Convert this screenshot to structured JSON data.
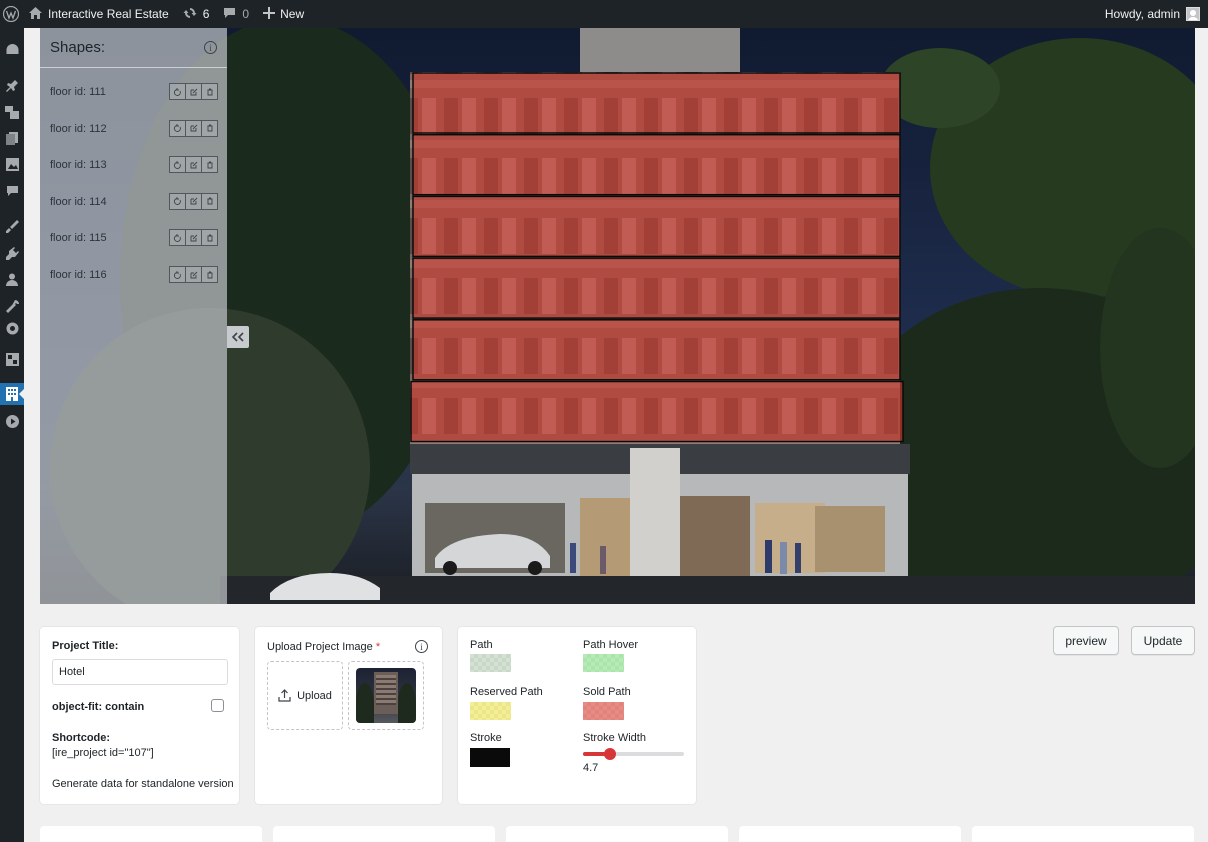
{
  "adminbar": {
    "site_name": "Interactive Real Estate",
    "updates_count": "6",
    "comments_count": "0",
    "new_label": "New",
    "howdy": "Howdy, admin",
    "icons": [
      "wordpress-logo-icon",
      "home-icon",
      "updates-icon",
      "comment-icon",
      "plus-icon",
      "avatar"
    ]
  },
  "adminmenu": {
    "items": [
      "dashboard-icon",
      "posts-icon",
      "media-icon",
      "pages-icon",
      "gallery-icon",
      "comments-icon",
      "appearance-icon",
      "plugins-icon",
      "users-icon",
      "tools-icon",
      "settings-icon",
      "blocks-icon",
      "interactive-real-estate-icon",
      "play-icon"
    ],
    "active": "interactive-real-estate-icon"
  },
  "shapes_panel": {
    "title": "Shapes:",
    "items": [
      {
        "label": "floor id: 111"
      },
      {
        "label": "floor id: 112"
      },
      {
        "label": "floor id: 113"
      },
      {
        "label": "floor id: 114"
      },
      {
        "label": "floor id: 115"
      },
      {
        "label": "floor id: 116"
      }
    ],
    "item_actions": [
      "refresh-icon",
      "edit-icon",
      "delete-icon"
    ],
    "highlight_color": "#c8322a",
    "overlay_color": "rgba(215,55,45,0.58)"
  },
  "project": {
    "title_label": "Project Title:",
    "title_value": "Hotel",
    "object_fit_label": "object-fit: contain",
    "object_fit_checked": false,
    "shortcode_label": "Shortcode:",
    "shortcode_value": "[ire_project id=\"107\"]",
    "generate_label": "Generate data for standalone version"
  },
  "upload": {
    "label": "Upload Project Image",
    "required_mark": "*",
    "button_label": "Upload"
  },
  "colors": {
    "path_label": "Path",
    "path_color": "rgba(160,190,160,0.45)",
    "path_hover_label": "Path Hover",
    "path_hover_color": "rgba(120,220,120,0.55)",
    "reserved_label": "Reserved Path",
    "reserved_color": "rgba(235,225,60,0.55)",
    "sold_label": "Sold Path",
    "sold_color": "rgba(215,55,45,0.58)",
    "stroke_label": "Stroke",
    "stroke_color": "#0a0a0a",
    "stroke_width_label": "Stroke Width",
    "stroke_width_value": "4.7",
    "stroke_width_fraction": 0.27,
    "slider_color": "#d63638"
  },
  "actions": {
    "preview_label": "preview",
    "update_label": "Update"
  }
}
